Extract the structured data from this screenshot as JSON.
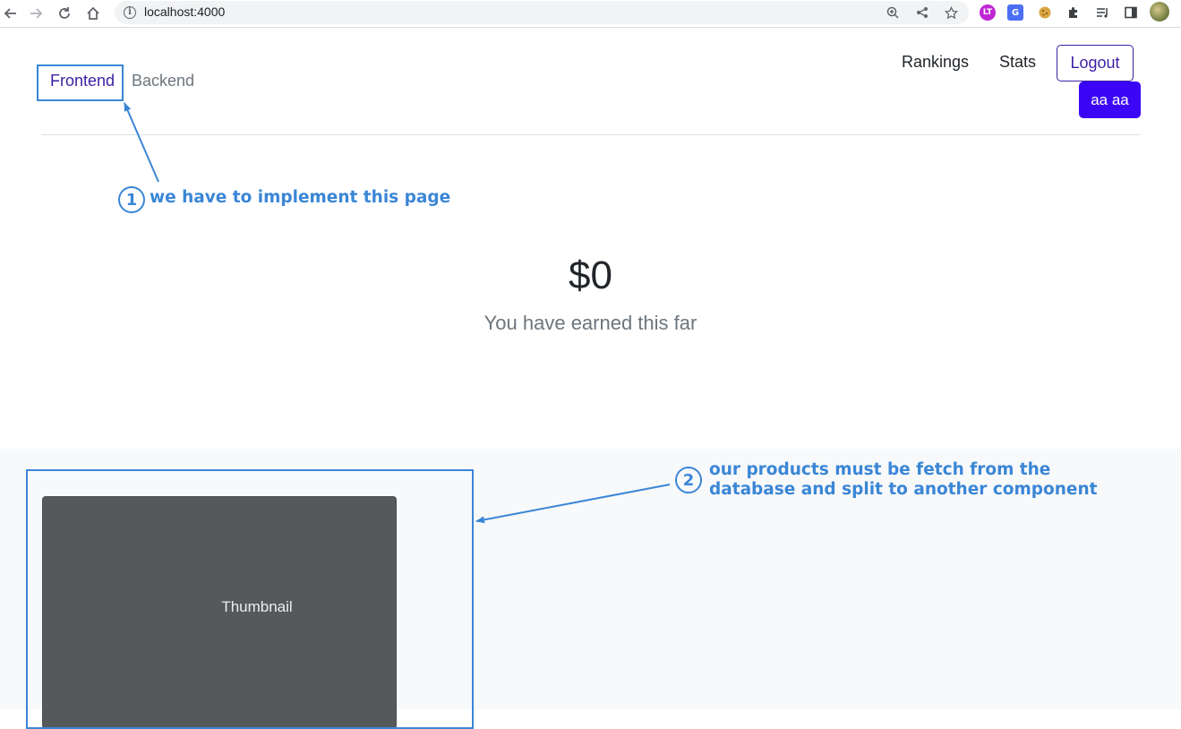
{
  "browser": {
    "url": "localhost:4000",
    "nav_icons": [
      "back-icon",
      "forward-icon",
      "reload-icon",
      "home-icon"
    ],
    "url_icons": [
      "zoom-icon",
      "share-icon",
      "star-icon"
    ],
    "extension_icons": [
      "ext-lt-icon",
      "google-translate-icon",
      "cookie-icon",
      "puzzle-icon",
      "media-list-icon",
      "side-panel-icon",
      "profile-avatar-icon"
    ]
  },
  "tabs": {
    "frontend": "Frontend",
    "backend": "Backend"
  },
  "nav": {
    "rankings": "Rankings",
    "stats": "Stats",
    "logout": "Logout",
    "user": "aa aa"
  },
  "earnings": {
    "amount": "$0",
    "caption": "You have earned this far"
  },
  "products": {
    "thumbnail_label": "Thumbnail"
  },
  "annotations": {
    "note1_number": "1",
    "note1_text": "we have to implement this page",
    "note2_number": "2",
    "note2_line1": "our products must be fetch from the",
    "note2_line2": "database and split to another component",
    "color": "#3a86d6"
  },
  "colors": {
    "primary": "#3d1fa3",
    "user_button": "#3b06f5",
    "thumbnail_bg": "#55595c",
    "section_bg": "#f8f9fa"
  }
}
